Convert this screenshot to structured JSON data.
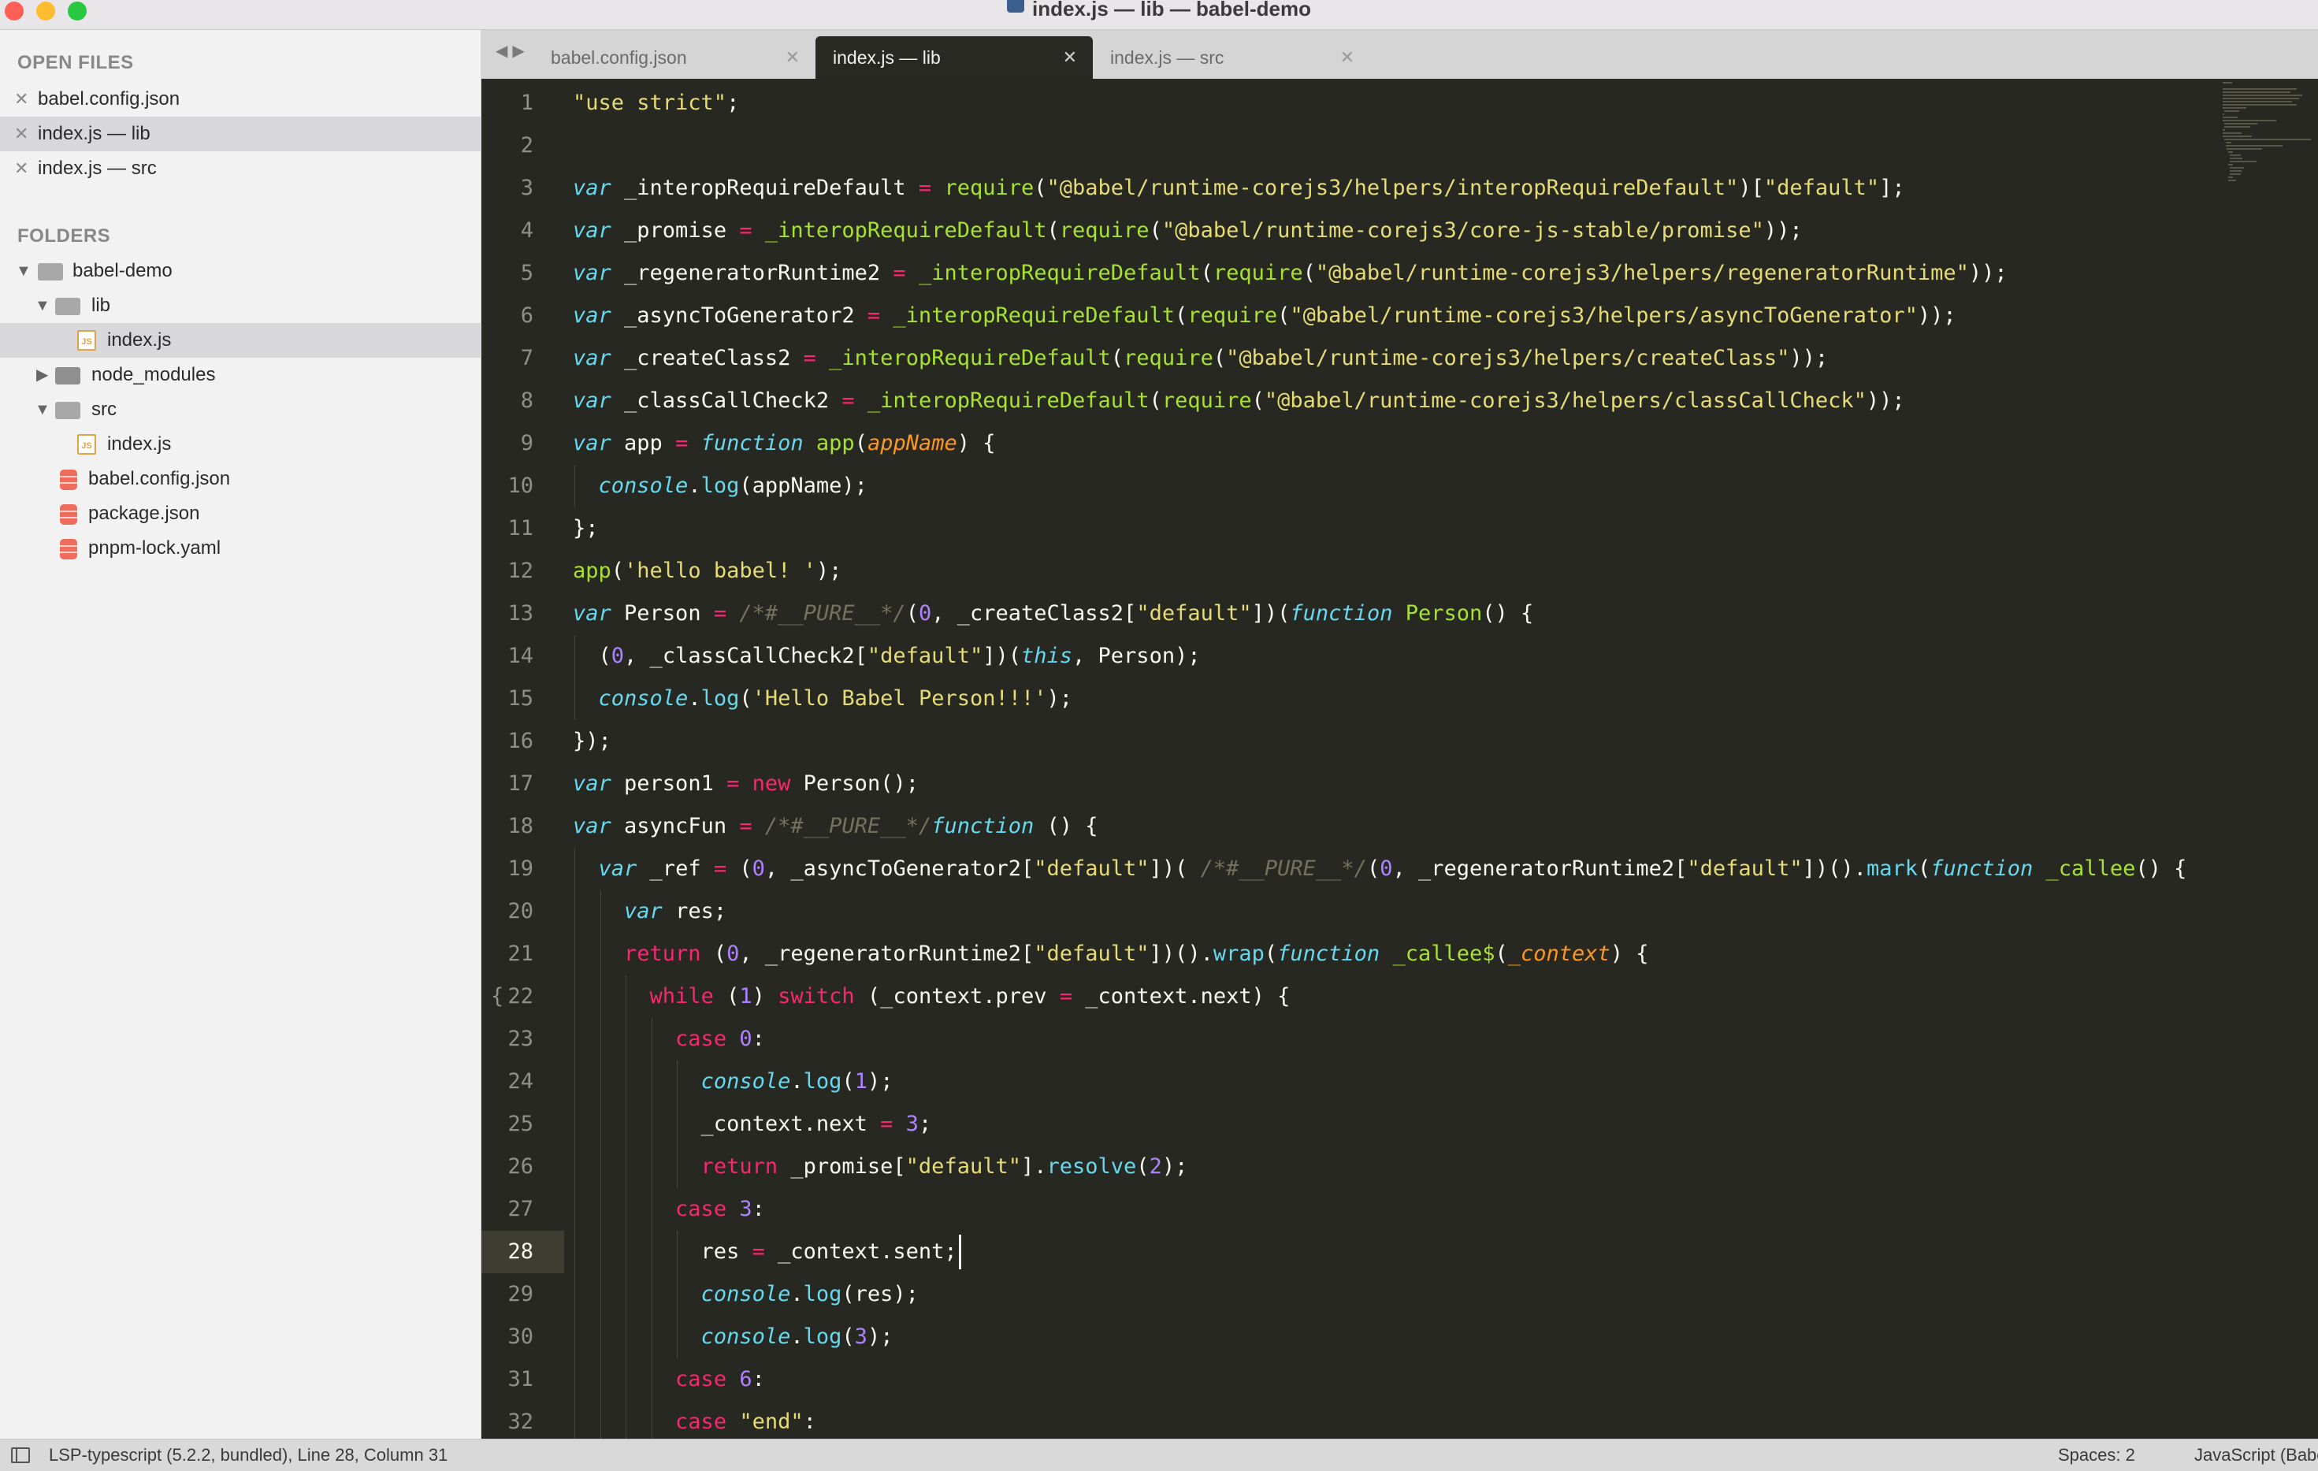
{
  "window": {
    "title": "index.js — lib — babel-demo"
  },
  "sidebar": {
    "open_files_title": "OPEN FILES",
    "open_files": [
      {
        "label": "babel.config.json"
      },
      {
        "label": "index.js — lib"
      },
      {
        "label": "index.js — src"
      }
    ],
    "folders_title": "FOLDERS",
    "tree": [
      {
        "label": "babel-demo",
        "kind": "folder-open"
      },
      {
        "label": "lib",
        "kind": "folder-open"
      },
      {
        "label": "index.js",
        "kind": "js-file"
      },
      {
        "label": "node_modules",
        "kind": "folder-closed"
      },
      {
        "label": "src",
        "kind": "folder-open"
      },
      {
        "label": "index.js",
        "kind": "js-file"
      },
      {
        "label": "babel.config.json",
        "kind": "db-file"
      },
      {
        "label": "package.json",
        "kind": "db-file"
      },
      {
        "label": "pnpm-lock.yaml",
        "kind": "db-file"
      }
    ]
  },
  "tabs": [
    {
      "label": "babel.config.json",
      "active": false
    },
    {
      "label": "index.js — lib",
      "active": true
    },
    {
      "label": "index.js — src",
      "active": false
    }
  ],
  "editor": {
    "current_line": 28,
    "lines": [
      {
        "n": 1,
        "code": "\"use strict\";"
      },
      {
        "n": 2,
        "code": ""
      },
      {
        "n": 3,
        "code": "var _interopRequireDefault = require(\"@babel/runtime-corejs3/helpers/interopRequireDefault\")[\"default\"];"
      },
      {
        "n": 4,
        "code": "var _promise = _interopRequireDefault(require(\"@babel/runtime-corejs3/core-js-stable/promise\"));"
      },
      {
        "n": 5,
        "code": "var _regeneratorRuntime2 = _interopRequireDefault(require(\"@babel/runtime-corejs3/helpers/regeneratorRuntime\"));"
      },
      {
        "n": 6,
        "code": "var _asyncToGenerator2 = _interopRequireDefault(require(\"@babel/runtime-corejs3/helpers/asyncToGenerator\"));"
      },
      {
        "n": 7,
        "code": "var _createClass2 = _interopRequireDefault(require(\"@babel/runtime-corejs3/helpers/createClass\"));"
      },
      {
        "n": 8,
        "code": "var _classCallCheck2 = _interopRequireDefault(require(\"@babel/runtime-corejs3/helpers/classCallCheck\"));"
      },
      {
        "n": 9,
        "code": "var app = function app(appName) {"
      },
      {
        "n": 10,
        "code": "  console.log(appName);"
      },
      {
        "n": 11,
        "code": "};"
      },
      {
        "n": 12,
        "code": "app('hello babel! ');"
      },
      {
        "n": 13,
        "code": "var Person = /*#__PURE__*/(0, _createClass2[\"default\"])(function Person() {"
      },
      {
        "n": 14,
        "code": "  (0, _classCallCheck2[\"default\"])(this, Person);"
      },
      {
        "n": 15,
        "code": "  console.log('Hello Babel Person!!!');"
      },
      {
        "n": 16,
        "code": "});"
      },
      {
        "n": 17,
        "code": "var person1 = new Person();"
      },
      {
        "n": 18,
        "code": "var asyncFun = /*#__PURE__*/function () {"
      },
      {
        "n": 19,
        "code": "  var _ref = (0, _asyncToGenerator2[\"default\"])( /*#__PURE__*/(0, _regeneratorRuntime2[\"default\"])().mark(function _callee() {"
      },
      {
        "n": 20,
        "code": "    var res;"
      },
      {
        "n": 21,
        "code": "    return (0, _regeneratorRuntime2[\"default\"])().wrap(function _callee$(_context) {"
      },
      {
        "n": 22,
        "code": "      while (1) switch (_context.prev = _context.next) {"
      },
      {
        "n": 23,
        "code": "        case 0:"
      },
      {
        "n": 24,
        "code": "          console.log(1);"
      },
      {
        "n": 25,
        "code": "          _context.next = 3;"
      },
      {
        "n": 26,
        "code": "          return _promise[\"default\"].resolve(2);"
      },
      {
        "n": 27,
        "code": "        case 3:"
      },
      {
        "n": 28,
        "code": "          res = _context.sent;"
      },
      {
        "n": 29,
        "code": "          console.log(res);"
      },
      {
        "n": 30,
        "code": "          console.log(3);"
      },
      {
        "n": 31,
        "code": "        case 6:"
      },
      {
        "n": 32,
        "code": "        case \"end\":"
      }
    ]
  },
  "statusbar": {
    "left": "LSP-typescript (5.2.2, bundled), Line 28, Column 31",
    "spaces": "Spaces: 2",
    "syntax": "JavaScript (Babel)"
  },
  "colors": {
    "editor_bg": "#272822",
    "keyword": "#66d9ef",
    "operator": "#f92672",
    "function": "#a6e22e",
    "string": "#e6db74",
    "number": "#ae81ff",
    "comment": "#75715e",
    "parameter": "#fd971f"
  },
  "icons": {
    "close": "close-icon",
    "folder": "folder-icon",
    "js_file": "js-file-icon",
    "config_file": "config-file-icon",
    "disclosure": "disclosure-triangle-icon",
    "nav": "nav-arrows-icon",
    "sidebar_toggle": "sidebar-toggle-icon"
  }
}
